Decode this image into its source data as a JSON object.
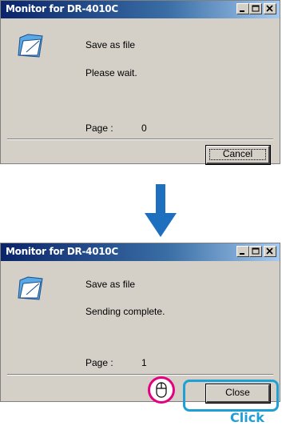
{
  "window_before": {
    "title": "Monitor for DR-4010C",
    "line1": "Save as file",
    "line2": "Please wait.",
    "page_label": "Page :",
    "page_value": "0",
    "button_label": "Cancel"
  },
  "window_after": {
    "title": "Monitor for DR-4010C",
    "line1": "Save as file",
    "line2": "Sending complete.",
    "page_label": "Page :",
    "page_value": "1",
    "button_label": "Close"
  },
  "annotation": {
    "click_label": "Click"
  },
  "colors": {
    "arrow": "#1f6fbf",
    "highlight": "#1e9fd6",
    "mouse_circle": "#e4007f"
  }
}
